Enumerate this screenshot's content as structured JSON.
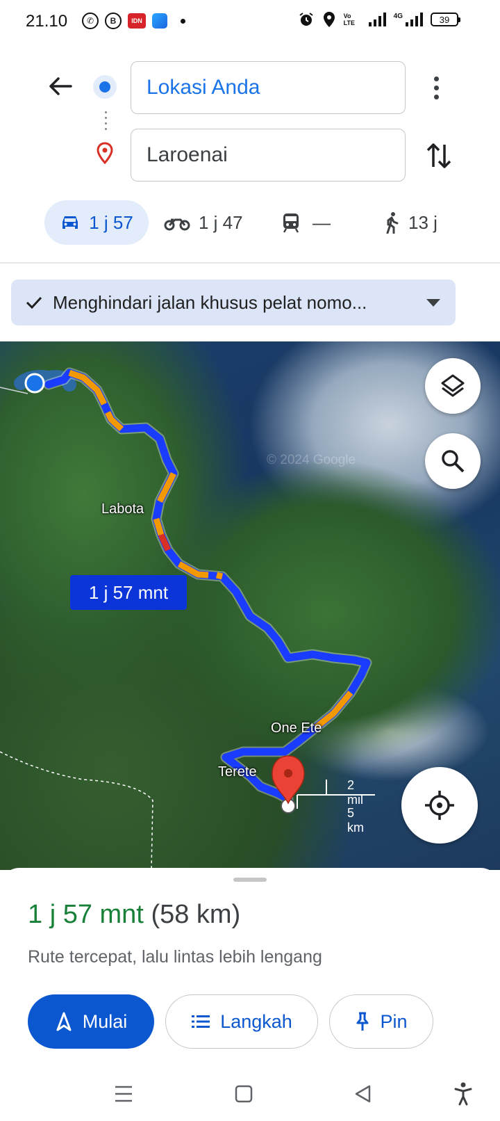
{
  "status_bar": {
    "time": "21.10",
    "battery": "39",
    "network": "4G",
    "volte": "Vo LTE",
    "b_icon": "B",
    "idn_icon": "IDN"
  },
  "directions": {
    "origin": "Lokasi Anda",
    "destination": "Laroenai"
  },
  "modes": [
    {
      "icon": "car-icon",
      "label": "1 j 57"
    },
    {
      "icon": "motorcycle-icon",
      "label": "1 j 47"
    },
    {
      "icon": "train-icon",
      "label": "—"
    },
    {
      "icon": "walk-icon",
      "label": "13 j"
    }
  ],
  "options_chip": {
    "label": "Menghindari jalan khusus pelat nomo..."
  },
  "map": {
    "labels": {
      "labota": "Labota",
      "one_ete": "One Ete",
      "terete": "Terete"
    },
    "watermark": "© 2024 Google",
    "route_time": "1 j 57 mnt",
    "scale_top": "2 mil",
    "scale_bottom": "5 km"
  },
  "summary": {
    "duration": "1 j 57 mnt",
    "distance": "(58 km)",
    "description": "Rute tercepat, lalu lintas lebih lengang"
  },
  "actions": {
    "start": "Mulai",
    "steps": "Langkah",
    "pin": "Pin"
  },
  "colors": {
    "accent": "#0b57d0",
    "duration_green": "#188038",
    "route_blue": "#1a3cff",
    "route_orange": "#f29900",
    "route_red": "#d93025"
  }
}
